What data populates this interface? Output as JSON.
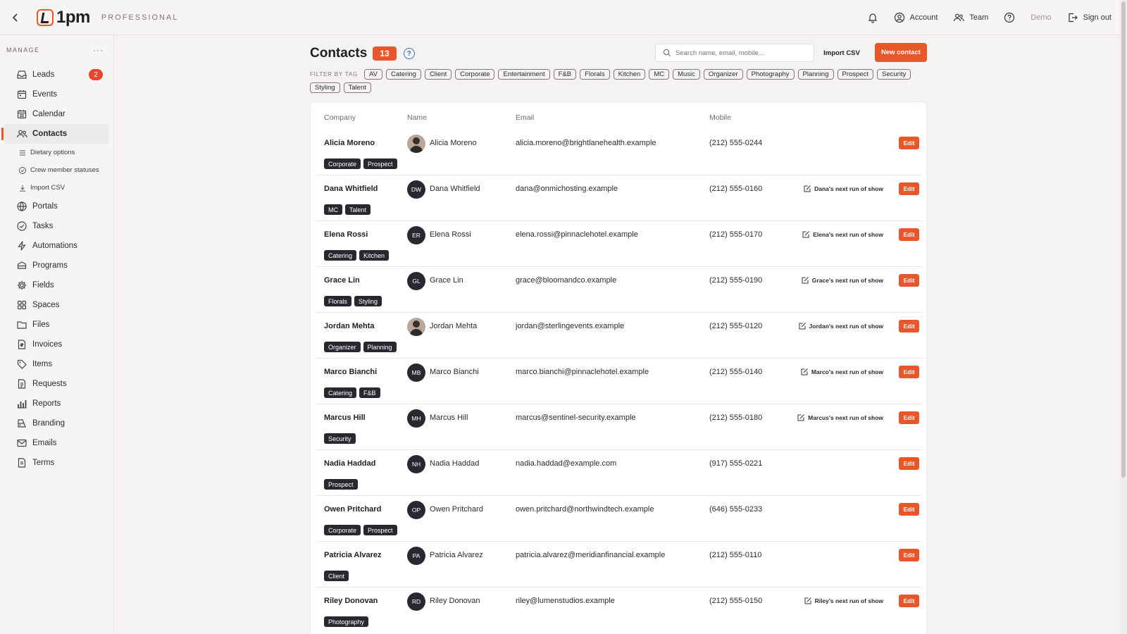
{
  "topbar": {
    "brand": "1pm",
    "plan": "PROFESSIONAL",
    "account": "Account",
    "team": "Team",
    "demo": "Demo",
    "signout": "Sign out"
  },
  "sidebar": {
    "heading": "MANAGE",
    "more": "···",
    "items": [
      {
        "label": "Leads",
        "icon": "inbox-icon",
        "badge": "2"
      },
      {
        "label": "Events",
        "icon": "calendar-event-icon"
      },
      {
        "label": "Calendar",
        "icon": "calendar-icon"
      },
      {
        "label": "Contacts",
        "icon": "users-icon",
        "active": true
      },
      {
        "label": "Portals",
        "icon": "globe-icon"
      },
      {
        "label": "Tasks",
        "icon": "check-circle-icon"
      },
      {
        "label": "Automations",
        "icon": "bolt-icon"
      },
      {
        "label": "Programs",
        "icon": "layers-icon"
      },
      {
        "label": "Fields",
        "icon": "gear-icon"
      },
      {
        "label": "Spaces",
        "icon": "grid-icon"
      },
      {
        "label": "Files",
        "icon": "folder-icon"
      },
      {
        "label": "Invoices",
        "icon": "invoice-icon"
      },
      {
        "label": "Items",
        "icon": "tag-icon"
      },
      {
        "label": "Requests",
        "icon": "document-icon"
      },
      {
        "label": "Reports",
        "icon": "bar-chart-icon"
      },
      {
        "label": "Branding",
        "icon": "palette-icon"
      },
      {
        "label": "Emails",
        "icon": "mail-icon"
      },
      {
        "label": "Terms",
        "icon": "file-text-icon"
      }
    ],
    "subitems": [
      {
        "label": "Dietary options",
        "icon": "list-icon"
      },
      {
        "label": "Crew member statuses",
        "icon": "check-circle-icon"
      },
      {
        "label": "Import CSV",
        "icon": "download-icon"
      }
    ]
  },
  "main": {
    "title": "Contacts",
    "count": "13",
    "help": "?",
    "search_placeholder": "Search name, email, mobile...",
    "import_csv": "Import CSV",
    "new_contact": "New contact",
    "filter_label": "FILTER BY TAG",
    "filter_tags": [
      "AV",
      "Catering",
      "Client",
      "Corporate",
      "Entertainment",
      "F&B",
      "Florals",
      "Kitchen",
      "MC",
      "Music",
      "Organizer",
      "Photography",
      "Planning",
      "Prospect",
      "Security",
      "Styling",
      "Talent"
    ]
  },
  "table": {
    "columns": [
      "Company",
      "Name",
      "Email",
      "Mobile"
    ],
    "edit_label": "Edit",
    "rows": [
      {
        "company": "Alicia Moreno",
        "name": "Alicia Moreno",
        "initials": "",
        "photo": true,
        "email": "alicia.moreno@brightlanehealth.example",
        "mobile": "(212) 555-0244",
        "run_show": "",
        "tags": [
          "Corporate",
          "Prospect"
        ]
      },
      {
        "company": "Dana Whitfield",
        "name": "Dana Whitfield",
        "initials": "DW",
        "email": "dana@onmichosting.example",
        "mobile": "(212) 555-0160",
        "run_show": "Dana's next run of show",
        "tags": [
          "MC",
          "Talent"
        ]
      },
      {
        "company": "Elena Rossi",
        "name": "Elena Rossi",
        "initials": "ER",
        "email": "elena.rossi@pinnaclehotel.example",
        "mobile": "(212) 555-0170",
        "run_show": "Elena's next run of show",
        "tags": [
          "Catering",
          "Kitchen"
        ]
      },
      {
        "company": "Grace Lin",
        "name": "Grace Lin",
        "initials": "GL",
        "email": "grace@bloomandco.example",
        "mobile": "(212) 555-0190",
        "run_show": "Grace's next run of show",
        "tags": [
          "Florals",
          "Styling"
        ]
      },
      {
        "company": "Jordan Mehta",
        "name": "Jordan Mehta",
        "initials": "",
        "photo": true,
        "email": "jordan@sterlingevents.example",
        "mobile": "(212) 555-0120",
        "run_show": "Jordan's next run of show",
        "tags": [
          "Organizer",
          "Planning"
        ]
      },
      {
        "company": "Marco Bianchi",
        "name": "Marco Bianchi",
        "initials": "MB",
        "email": "marco.bianchi@pinnaclehotel.example",
        "mobile": "(212) 555-0140",
        "run_show": "Marco's next run of show",
        "tags": [
          "Catering",
          "F&B"
        ]
      },
      {
        "company": "Marcus Hill",
        "name": "Marcus Hill",
        "initials": "MH",
        "email": "marcus@sentinel-security.example",
        "mobile": "(212) 555-0180",
        "run_show": "Marcus's next run of show",
        "tags": [
          "Security"
        ]
      },
      {
        "company": "Nadia Haddad",
        "name": "Nadia Haddad",
        "initials": "NH",
        "email": "nadia.haddad@example.com",
        "mobile": "(917) 555-0221",
        "run_show": "",
        "tags": [
          "Prospect"
        ]
      },
      {
        "company": "Owen Pritchard",
        "name": "Owen Pritchard",
        "initials": "OP",
        "email": "owen.pritchard@northwindtech.example",
        "mobile": "(646) 555-0233",
        "run_show": "",
        "tags": [
          "Corporate",
          "Prospect"
        ]
      },
      {
        "company": "Patricia Alvarez",
        "name": "Patricia Alvarez",
        "initials": "PA",
        "email": "patricia.alvarez@meridianfinancial.example",
        "mobile": "(212) 555-0110",
        "run_show": "",
        "tags": [
          "Client"
        ]
      },
      {
        "company": "Riley Donovan",
        "name": "Riley Donovan",
        "initials": "RD",
        "email": "riley@lumenstudios.example",
        "mobile": "(212) 555-0150",
        "run_show": "Riley's next run of show",
        "tags": [
          "Photography"
        ]
      }
    ]
  },
  "colors": {
    "accent": "#e8562a",
    "badge": "#e8452f",
    "tag_dark": "#2a2730",
    "link_blue": "#3b6fc9"
  }
}
